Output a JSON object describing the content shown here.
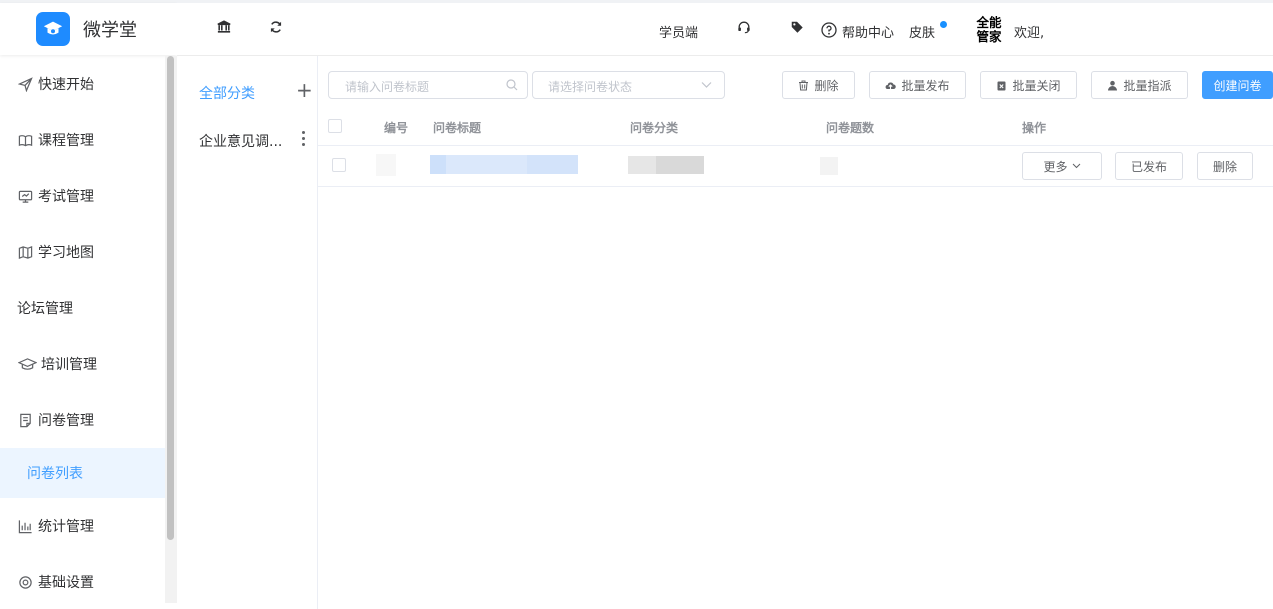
{
  "app": {
    "name": "微学堂"
  },
  "header": {
    "student_label": "学员端",
    "help_label": "帮助中心",
    "skin_label": "皮肤",
    "brand_line1": "全能",
    "brand_line2": "管家",
    "welcome": "欢迎,"
  },
  "sidebar": {
    "items": [
      {
        "label": "快速开始",
        "icon": "send-icon"
      },
      {
        "label": "课程管理",
        "icon": "book-icon"
      },
      {
        "label": "考试管理",
        "icon": "monitor-icon"
      },
      {
        "label": "学习地图",
        "icon": "map-icon"
      },
      {
        "label": "论坛管理",
        "icon": ""
      },
      {
        "label": "培训管理",
        "icon": "graduation-cap-icon"
      },
      {
        "label": "问卷管理",
        "icon": "document-icon"
      },
      {
        "label": "问卷列表",
        "icon": ""
      },
      {
        "label": "统计管理",
        "icon": "bar-chart-icon"
      },
      {
        "label": "基础设置",
        "icon": "settings-icon"
      }
    ]
  },
  "categories": {
    "all_label": "全部分类",
    "items": [
      {
        "label": "企业意见调..."
      }
    ]
  },
  "toolbar": {
    "search_placeholder": "请输入问卷标题",
    "status_placeholder": "请选择问卷状态",
    "delete_label": "删除",
    "batch_publish_label": "批量发布",
    "batch_close_label": "批量关闭",
    "batch_assign_label": "批量指派",
    "create_label": "创建问卷"
  },
  "table": {
    "columns": [
      "编号",
      "问卷标题",
      "问卷分类",
      "问卷题数",
      "操作"
    ],
    "rows": [
      {
        "more_label": "更多",
        "status_label": "已发布",
        "delete_label": "删除"
      }
    ]
  },
  "colors": {
    "primary": "#409eff",
    "brand": "#1e8bff",
    "active_bg": "#ecf5ff"
  }
}
